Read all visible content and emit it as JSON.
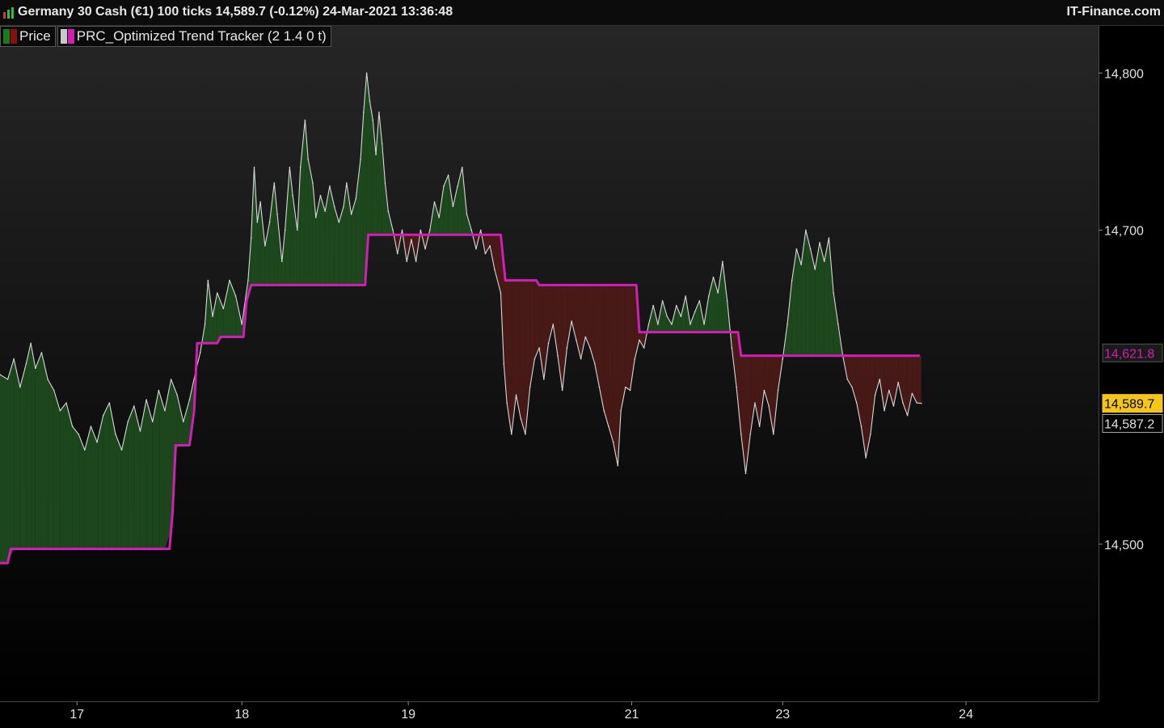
{
  "header": {
    "title": "Germany 30 Cash (€1) 100 ticks 14,589.7 (-0.12%) 24-Mar-2021 13:36:48",
    "brand": "IT-Finance.com"
  },
  "legend": {
    "price_label": "Price",
    "indicator_label": "PRC_Optimized Trend Tracker (2 1.4 0 t)"
  },
  "colors": {
    "indicator": "#d21fb3",
    "bull_fill": "#1e4a1e",
    "bear_fill": "#4a1a18",
    "price_line": "#d8d8d8",
    "current_price_bg": "#f5c518",
    "background_top": "#262626",
    "background_bottom": "#000000"
  },
  "chart_data": {
    "type": "line",
    "ylim": [
      14400,
      14830
    ],
    "yticks": [
      {
        "value": 14800,
        "label": "14,800"
      },
      {
        "value": 14700,
        "label": "14,700"
      },
      {
        "value": 14500,
        "label": "14,500"
      }
    ],
    "xticks": [
      {
        "x": 0.35,
        "label": "17"
      },
      {
        "x": 1.42,
        "label": "18"
      },
      {
        "x": 2.5,
        "label": "19"
      },
      {
        "x": 3.95,
        "label": "21"
      },
      {
        "x": 4.93,
        "label": "23"
      },
      {
        "x": 6.12,
        "label": "24"
      }
    ],
    "xlim": [
      -0.15,
      6.98
    ],
    "price_points": [
      [
        -0.15,
        14608
      ],
      [
        -0.1,
        14605
      ],
      [
        -0.06,
        14618
      ],
      [
        -0.02,
        14600
      ],
      [
        0.02,
        14615
      ],
      [
        0.05,
        14628
      ],
      [
        0.08,
        14612
      ],
      [
        0.12,
        14622
      ],
      [
        0.16,
        14605
      ],
      [
        0.2,
        14598
      ],
      [
        0.24,
        14585
      ],
      [
        0.28,
        14590
      ],
      [
        0.32,
        14575
      ],
      [
        0.36,
        14570
      ],
      [
        0.4,
        14560
      ],
      [
        0.44,
        14575
      ],
      [
        0.48,
        14565
      ],
      [
        0.52,
        14582
      ],
      [
        0.56,
        14590
      ],
      [
        0.6,
        14570
      ],
      [
        0.64,
        14560
      ],
      [
        0.68,
        14578
      ],
      [
        0.72,
        14588
      ],
      [
        0.76,
        14572
      ],
      [
        0.8,
        14592
      ],
      [
        0.84,
        14578
      ],
      [
        0.88,
        14598
      ],
      [
        0.92,
        14585
      ],
      [
        0.96,
        14605
      ],
      [
        1.0,
        14595
      ],
      [
        1.04,
        14578
      ],
      [
        1.08,
        14592
      ],
      [
        1.12,
        14610
      ],
      [
        1.15,
        14622
      ],
      [
        1.18,
        14640
      ],
      [
        1.2,
        14668
      ],
      [
        1.23,
        14645
      ],
      [
        1.26,
        14660
      ],
      [
        1.3,
        14650
      ],
      [
        1.34,
        14668
      ],
      [
        1.38,
        14658
      ],
      [
        1.42,
        14640
      ],
      [
        1.46,
        14668
      ],
      [
        1.48,
        14695
      ],
      [
        1.5,
        14740
      ],
      [
        1.52,
        14705
      ],
      [
        1.54,
        14718
      ],
      [
        1.57,
        14690
      ],
      [
        1.6,
        14705
      ],
      [
        1.63,
        14730
      ],
      [
        1.65,
        14710
      ],
      [
        1.68,
        14680
      ],
      [
        1.7,
        14700
      ],
      [
        1.73,
        14740
      ],
      [
        1.75,
        14722
      ],
      [
        1.78,
        14700
      ],
      [
        1.8,
        14740
      ],
      [
        1.83,
        14770
      ],
      [
        1.85,
        14745
      ],
      [
        1.88,
        14730
      ],
      [
        1.9,
        14708
      ],
      [
        1.93,
        14722
      ],
      [
        1.96,
        14712
      ],
      [
        1.99,
        14728
      ],
      [
        2.02,
        14715
      ],
      [
        2.05,
        14705
      ],
      [
        2.08,
        14715
      ],
      [
        2.1,
        14730
      ],
      [
        2.13,
        14710
      ],
      [
        2.16,
        14720
      ],
      [
        2.19,
        14745
      ],
      [
        2.21,
        14775
      ],
      [
        2.23,
        14800
      ],
      [
        2.25,
        14782
      ],
      [
        2.27,
        14770
      ],
      [
        2.29,
        14748
      ],
      [
        2.31,
        14775
      ],
      [
        2.33,
        14755
      ],
      [
        2.35,
        14730
      ],
      [
        2.37,
        14712
      ],
      [
        2.4,
        14700
      ],
      [
        2.43,
        14685
      ],
      [
        2.46,
        14700
      ],
      [
        2.49,
        14680
      ],
      [
        2.52,
        14694
      ],
      [
        2.55,
        14680
      ],
      [
        2.58,
        14700
      ],
      [
        2.61,
        14688
      ],
      [
        2.64,
        14700
      ],
      [
        2.67,
        14718
      ],
      [
        2.7,
        14708
      ],
      [
        2.73,
        14728
      ],
      [
        2.76,
        14735
      ],
      [
        2.79,
        14715
      ],
      [
        2.82,
        14728
      ],
      [
        2.85,
        14740
      ],
      [
        2.88,
        14710
      ],
      [
        2.91,
        14700
      ],
      [
        2.94,
        14688
      ],
      [
        2.97,
        14700
      ],
      [
        3.0,
        14685
      ],
      [
        3.03,
        14690
      ],
      [
        3.06,
        14675
      ],
      [
        3.1,
        14660
      ],
      [
        3.12,
        14615
      ],
      [
        3.14,
        14590
      ],
      [
        3.17,
        14570
      ],
      [
        3.2,
        14595
      ],
      [
        3.23,
        14580
      ],
      [
        3.26,
        14570
      ],
      [
        3.29,
        14600
      ],
      [
        3.32,
        14618
      ],
      [
        3.35,
        14625
      ],
      [
        3.38,
        14605
      ],
      [
        3.41,
        14628
      ],
      [
        3.44,
        14640
      ],
      [
        3.47,
        14620
      ],
      [
        3.5,
        14598
      ],
      [
        3.53,
        14625
      ],
      [
        3.56,
        14642
      ],
      [
        3.59,
        14630
      ],
      [
        3.62,
        14618
      ],
      [
        3.65,
        14632
      ],
      [
        3.68,
        14625
      ],
      [
        3.71,
        14615
      ],
      [
        3.74,
        14600
      ],
      [
        3.77,
        14585
      ],
      [
        3.8,
        14575
      ],
      [
        3.83,
        14565
      ],
      [
        3.86,
        14550
      ],
      [
        3.88,
        14585
      ],
      [
        3.91,
        14600
      ],
      [
        3.94,
        14598
      ],
      [
        3.97,
        14618
      ],
      [
        4.0,
        14630
      ],
      [
        4.03,
        14625
      ],
      [
        4.06,
        14640
      ],
      [
        4.09,
        14652
      ],
      [
        4.12,
        14640
      ],
      [
        4.15,
        14655
      ],
      [
        4.18,
        14645
      ],
      [
        4.21,
        14640
      ],
      [
        4.24,
        14652
      ],
      [
        4.27,
        14645
      ],
      [
        4.3,
        14658
      ],
      [
        4.33,
        14640
      ],
      [
        4.36,
        14648
      ],
      [
        4.39,
        14655
      ],
      [
        4.42,
        14640
      ],
      [
        4.45,
        14658
      ],
      [
        4.48,
        14670
      ],
      [
        4.51,
        14660
      ],
      [
        4.54,
        14680
      ],
      [
        4.57,
        14655
      ],
      [
        4.6,
        14625
      ],
      [
        4.63,
        14600
      ],
      [
        4.66,
        14570
      ],
      [
        4.69,
        14545
      ],
      [
        4.72,
        14570
      ],
      [
        4.75,
        14590
      ],
      [
        4.78,
        14575
      ],
      [
        4.81,
        14598
      ],
      [
        4.84,
        14588
      ],
      [
        4.87,
        14570
      ],
      [
        4.9,
        14598
      ],
      [
        4.93,
        14618
      ],
      [
        4.96,
        14640
      ],
      [
        4.99,
        14668
      ],
      [
        5.02,
        14688
      ],
      [
        5.05,
        14678
      ],
      [
        5.08,
        14700
      ],
      [
        5.11,
        14688
      ],
      [
        5.14,
        14675
      ],
      [
        5.17,
        14692
      ],
      [
        5.2,
        14680
      ],
      [
        5.23,
        14695
      ],
      [
        5.26,
        14660
      ],
      [
        5.29,
        14640
      ],
      [
        5.32,
        14620
      ],
      [
        5.35,
        14605
      ],
      [
        5.38,
        14600
      ],
      [
        5.41,
        14590
      ],
      [
        5.44,
        14575
      ],
      [
        5.47,
        14555
      ],
      [
        5.5,
        14570
      ],
      [
        5.53,
        14595
      ],
      [
        5.56,
        14605
      ],
      [
        5.59,
        14585
      ],
      [
        5.62,
        14598
      ],
      [
        5.65,
        14588
      ],
      [
        5.68,
        14603
      ],
      [
        5.71,
        14590
      ],
      [
        5.74,
        14582
      ],
      [
        5.77,
        14596
      ],
      [
        5.8,
        14590
      ],
      [
        5.83,
        14589.7
      ]
    ],
    "indicator_points": [
      [
        -0.15,
        14488
      ],
      [
        -0.1,
        14488
      ],
      [
        -0.08,
        14497
      ],
      [
        0.95,
        14497
      ],
      [
        0.97,
        14520
      ],
      [
        0.99,
        14563
      ],
      [
        1.08,
        14563
      ],
      [
        1.11,
        14585
      ],
      [
        1.13,
        14628
      ],
      [
        1.26,
        14628
      ],
      [
        1.28,
        14632
      ],
      [
        1.43,
        14632
      ],
      [
        1.45,
        14655
      ],
      [
        1.48,
        14665
      ],
      [
        1.6,
        14665
      ],
      [
        2.22,
        14665
      ],
      [
        2.24,
        14697
      ],
      [
        3.1,
        14697
      ],
      [
        3.13,
        14668
      ],
      [
        3.33,
        14668
      ],
      [
        3.35,
        14665
      ],
      [
        3.98,
        14665
      ],
      [
        4.0,
        14635
      ],
      [
        4.64,
        14635
      ],
      [
        4.66,
        14620
      ],
      [
        5.82,
        14620
      ]
    ],
    "price_labels": [
      {
        "value": 14621.8,
        "label": "14,621.8",
        "style": "indicator"
      },
      {
        "value": 14589.7,
        "label": "14,589.7",
        "style": "current"
      },
      {
        "value": 14587.2,
        "label": "14,587.2",
        "style": "bid"
      }
    ]
  }
}
